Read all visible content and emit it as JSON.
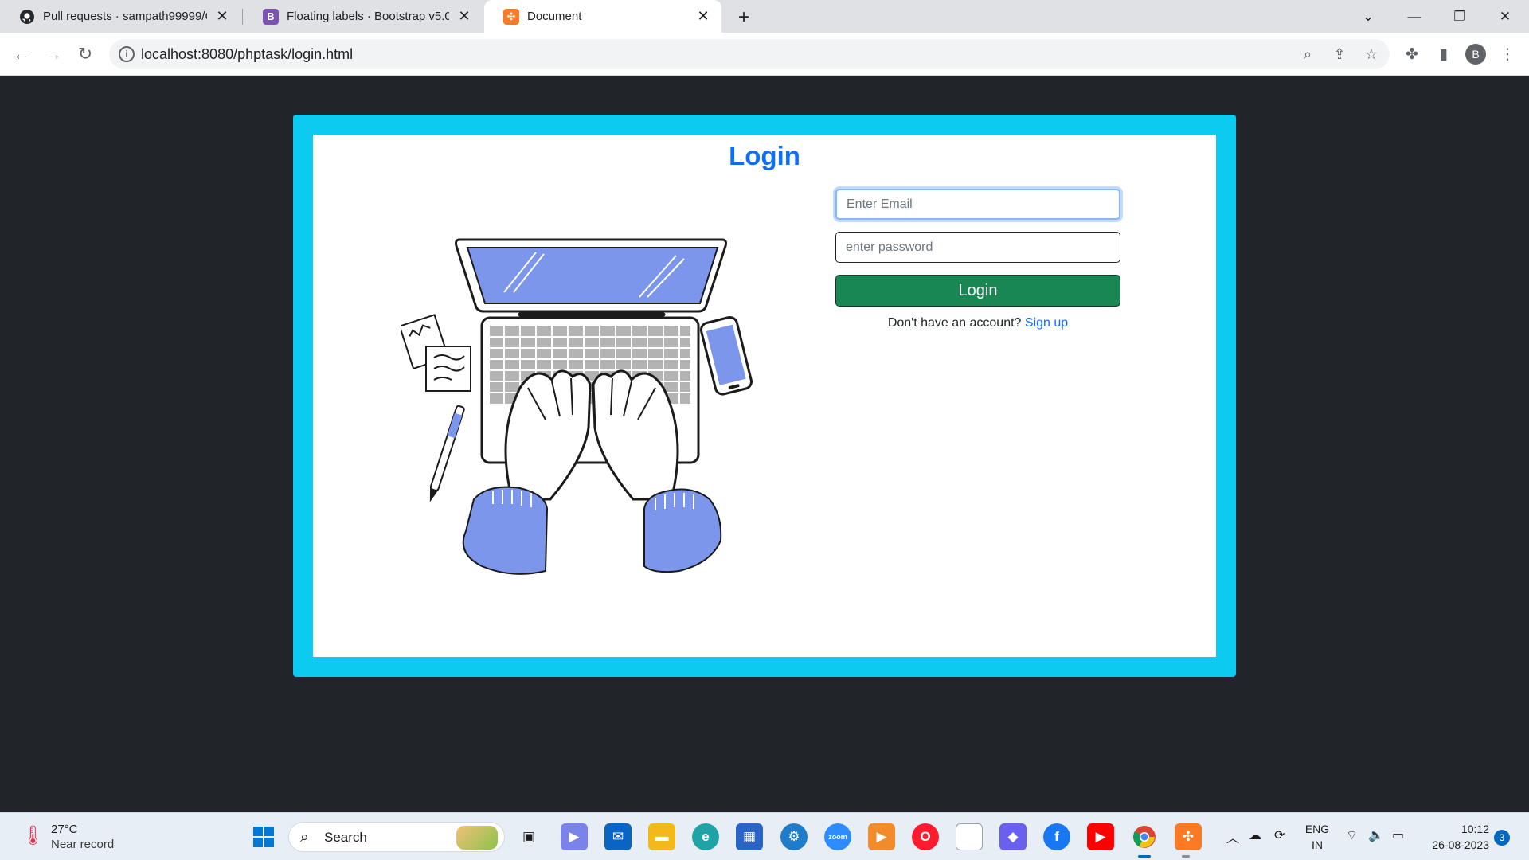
{
  "browser": {
    "tabs": [
      {
        "title": "Pull requests · sampath99999/Co",
        "icon": "github-icon"
      },
      {
        "title": "Floating labels · Bootstrap v5.0",
        "icon": "bootstrap-icon",
        "icon_text": "B"
      },
      {
        "title": "Document",
        "icon": "xampp-icon",
        "active": true
      }
    ],
    "url": "localhost:8080/phptask/login.html",
    "profile_initial": "B"
  },
  "page": {
    "title": "Login",
    "email_placeholder": "Enter Email",
    "password_placeholder": "enter password",
    "login_button": "Login",
    "signup_prompt": "Don't have an account?",
    "signup_link": "Sign up",
    "illustration": "laptop-typing-illustration",
    "colors": {
      "frame": "#0dcaf0",
      "title": "#0d6efd",
      "button": "#198754",
      "page_bg": "#212529"
    }
  },
  "taskbar": {
    "weather_temp": "27°C",
    "weather_desc": "Near record",
    "search_label": "Search",
    "lang_top": "ENG",
    "lang_bottom": "IN",
    "time": "10:12",
    "date": "26-08-2023",
    "notifications": "3"
  }
}
